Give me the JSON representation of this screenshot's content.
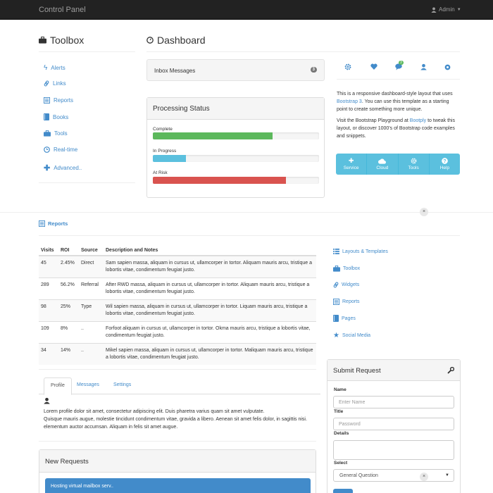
{
  "navbar": {
    "brand": "Control Panel",
    "user": "Admin"
  },
  "toolbox": {
    "title": "Toolbox",
    "items": [
      {
        "label": "Alerts",
        "icon": "flash-icon"
      },
      {
        "label": "Links",
        "icon": "link-icon"
      },
      {
        "label": "Reports",
        "icon": "list-alt-icon"
      },
      {
        "label": "Books",
        "icon": "book-icon"
      },
      {
        "label": "Tools",
        "icon": "briefcase-icon"
      },
      {
        "label": "Real-time",
        "icon": "clock-icon"
      },
      {
        "label": "Advanced..",
        "icon": "plus-icon"
      }
    ]
  },
  "dashboard": {
    "title": "Dashboard",
    "inbox": {
      "label": "Inbox Messages",
      "count": "3"
    },
    "processing": {
      "title": "Processing Status",
      "bars": [
        {
          "label": "Complete",
          "value": 0.72,
          "color": "#5cb85c"
        },
        {
          "label": "In Progress",
          "value": 0.2,
          "color": "#5bc0de"
        },
        {
          "label": "At Risk",
          "value": 0.8,
          "color": "#d9534f"
        }
      ]
    }
  },
  "icon_row": {
    "icons": [
      "cog-icon",
      "heart-icon",
      "comment-icon",
      "user-icon",
      "record-icon"
    ],
    "notification_count": "3"
  },
  "description": {
    "p1_before": "This is a responsive dashboard-style layout that uses ",
    "p1_link": "Bootstrap 3",
    "p1_after": ". You can use this template as a starting point to create something more unique.",
    "p2_before": "Visit the Bootstrap Playground at ",
    "p2_link": "Bootply",
    "p2_after": " to tweak this layout, or discover 1000's of Bootstrap code examples and snippets."
  },
  "action_buttons": [
    {
      "label": "Service",
      "icon": "plus-icon"
    },
    {
      "label": "Cloud",
      "icon": "cloud-icon"
    },
    {
      "label": "Tools",
      "icon": "cog-icon"
    },
    {
      "label": "Help",
      "icon": "question-icon"
    }
  ],
  "reports": {
    "title": "Reports",
    "columns": [
      "Visits",
      "ROI",
      "Source",
      "Description and Notes"
    ],
    "rows": [
      {
        "visits": "45",
        "roi": "2.45%",
        "source": "Direct",
        "desc": "Sam sapien massa, aliquam in cursus ut, ullamcorper in tortor. Aliquam mauris arcu, tristique a lobortis vitae, condimentum feugiat justo."
      },
      {
        "visits": "289",
        "roi": "56.2%",
        "source": "Referral",
        "desc": "After RWD massa, aliquam in cursus ut, ullamcorper in tortor. Aliquam mauris arcu, tristique a lobortis vitae, condimentum feugiat justo."
      },
      {
        "visits": "98",
        "roi": "25%",
        "source": "Type",
        "desc": "Wil sapien massa, aliquam in cursus ut, ullamcorper in tortor. Liquam mauris arcu, tristique a lobortis vitae, condimentum feugiat justo."
      },
      {
        "visits": "109",
        "roi": "8%",
        "source": "..",
        "desc": "Forfoot aliquam in cursus ut, ullamcorper in tortor. Okma mauris arcu, tristique a lobortis vitae, condimentum feugiat justo."
      },
      {
        "visits": "34",
        "roi": "14%",
        "source": "..",
        "desc": "Mikel sapien massa, aliquam in cursus ut, ullamcorper in tortor. Maliquam mauris arcu, tristique a lobortis vitae, condimentum feugiat justo."
      }
    ]
  },
  "right_links": [
    {
      "label": "Layouts & Templates",
      "icon": "list-icon"
    },
    {
      "label": "Toolbox",
      "icon": "briefcase-icon"
    },
    {
      "label": "Widgets",
      "icon": "link-icon"
    },
    {
      "label": "Reports",
      "icon": "list-alt-icon"
    },
    {
      "label": "Pages",
      "icon": "book-icon"
    },
    {
      "label": "Social Media",
      "icon": "star-icon"
    }
  ],
  "tabs": {
    "items": [
      "Profile",
      "Messages",
      "Settings"
    ],
    "active": "Profile",
    "profile_line1": "Lorem profile dolor sit amet, consectetur adipiscing elit. Duis pharetra varius quam sit amet vulputate.",
    "profile_line2": "Quisque mauris augue, molestie tincidunt condimentum vitae, gravida a libero. Aenean sit amet felis dolor, in sagittis nisi.",
    "profile_line3": "elementum auctor accumsan. Aliquam in felis sit amet augue."
  },
  "submit_request": {
    "title": "Submit Request",
    "name_label": "Name",
    "name_placeholder": "Enter Name",
    "title_label": "Title",
    "title_placeholder": "Password",
    "details_label": "Details",
    "select_label": "Select",
    "select_value": "General Question"
  },
  "new_requests": {
    "title": "New Requests",
    "first_item": "Hosting virtual mailbox serv.."
  }
}
